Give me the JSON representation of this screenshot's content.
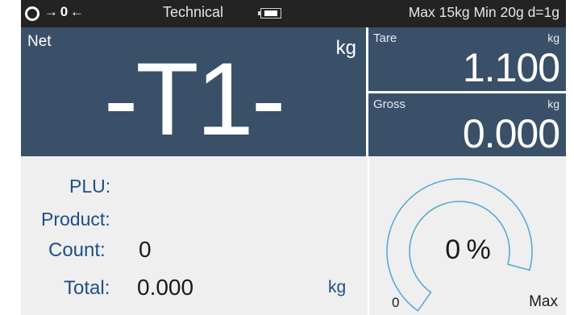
{
  "status_bar": {
    "zero_indicator": "→ 0 ←",
    "zero_icon": "circle-icon",
    "mode": "Technical",
    "battery_icon": "battery-icon",
    "battery_level_fraction": 0.75,
    "capacity": "Max 15kg Min 20g d=1g"
  },
  "net": {
    "label": "Net",
    "unit": "kg",
    "value": "-T1-"
  },
  "tare": {
    "label": "Tare",
    "unit": "kg",
    "value": "1.100"
  },
  "gross": {
    "label": "Gross",
    "unit": "kg",
    "value": "0.000"
  },
  "info": {
    "plu_label": "PLU:",
    "plu_value": "",
    "product_label": "Product:",
    "product_value": "",
    "count_label": "Count:",
    "count_value": "0",
    "total_label": "Total:",
    "total_value": "0.000",
    "total_unit": "kg"
  },
  "gauge": {
    "percent_text": "0 %",
    "percent_value": 0,
    "min_label": "0",
    "max_label": "Max",
    "arc_color": "#5aa9d6"
  },
  "colors": {
    "panel_blue": "#3a5068",
    "status_bar": "#232323",
    "label_blue": "#1f4e8a",
    "light_panel": "#efefef"
  }
}
